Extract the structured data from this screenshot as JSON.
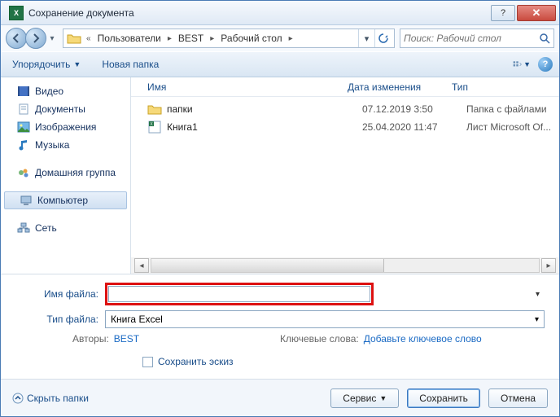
{
  "window": {
    "title": "Сохранение документа"
  },
  "address": {
    "segments": [
      "Пользователи",
      "BEST",
      "Рабочий стол"
    ],
    "prefix": "«"
  },
  "search": {
    "placeholder": "Поиск: Рабочий стол"
  },
  "toolbar": {
    "organize": "Упорядочить",
    "new_folder": "Новая папка"
  },
  "sidebar": {
    "video": "Видео",
    "documents": "Документы",
    "pictures": "Изображения",
    "music": "Музыка",
    "homegroup": "Домашняя группа",
    "computer": "Компьютер",
    "network": "Сеть"
  },
  "columns": {
    "name": "Имя",
    "date": "Дата изменения",
    "type": "Тип"
  },
  "files": [
    {
      "name": "папки",
      "date": "07.12.2019 3:50",
      "type": "Папка с файлами",
      "icon": "folder"
    },
    {
      "name": "Книга1",
      "date": "25.04.2020 11:47",
      "type": "Лист Microsoft Of...",
      "icon": "excel"
    }
  ],
  "fields": {
    "filename_label": "Имя файла:",
    "filename_value": "",
    "type_label": "Тип файла:",
    "type_value": "Книга Excel"
  },
  "meta": {
    "authors_label": "Авторы:",
    "authors_value": "BEST",
    "keywords_label": "Ключевые слова:",
    "keywords_value": "Добавьте ключевое слово"
  },
  "thumb": {
    "label": "Сохранить эскиз"
  },
  "footer": {
    "hide_folders": "Скрыть папки",
    "tools": "Сервис",
    "save": "Сохранить",
    "cancel": "Отмена"
  }
}
